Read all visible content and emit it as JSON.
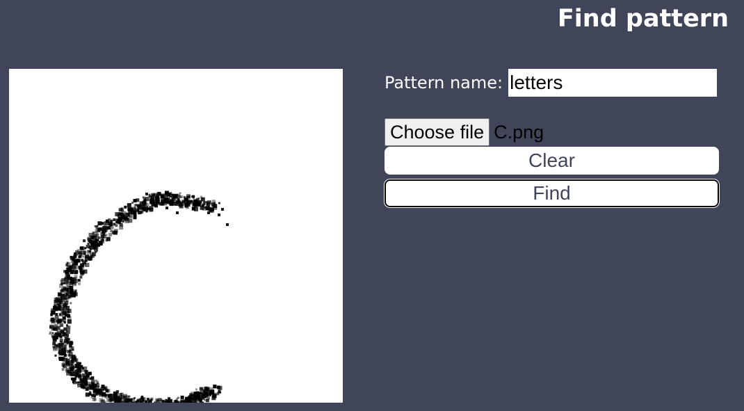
{
  "header": {
    "title": "Find pattern"
  },
  "form": {
    "pattern_name_label": "Pattern name:",
    "pattern_name_value": "letters",
    "file_button_label": "Choose file",
    "file_name": "C.png",
    "clear_label": "Clear",
    "find_label": "Find"
  },
  "canvas": {
    "drawn_glyph": "C",
    "background_color": "#ffffff",
    "ink_color": "#000000"
  },
  "colors": {
    "page_background": "#414559",
    "button_text": "#414559"
  }
}
